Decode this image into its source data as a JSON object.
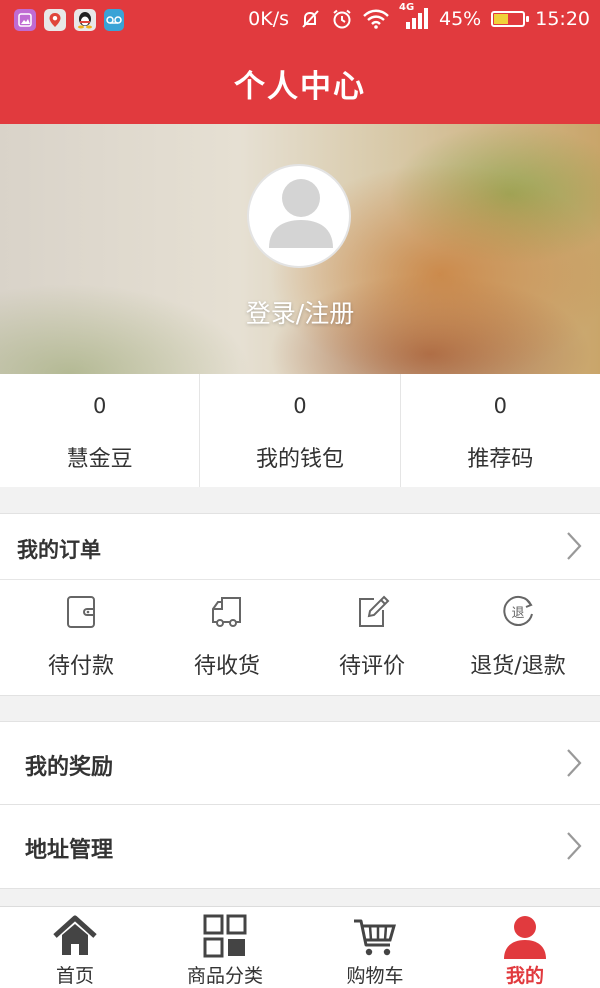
{
  "status_bar": {
    "apps": [
      {
        "icon": "image-app-icon",
        "color": "#c06bd3"
      },
      {
        "icon": "map-pin-app-icon",
        "color": "#e8e8e8"
      },
      {
        "icon": "qq-penguin-app-icon",
        "color": "#e8e8e8"
      },
      {
        "icon": "voicemail-app-icon",
        "color": "#3aa3d6"
      }
    ],
    "network_speed": "0K/s",
    "network_type": "4G",
    "battery_percent_text": "45%",
    "battery_level": 0.45,
    "time": "15:20"
  },
  "header": {
    "title": "个人中心"
  },
  "profile": {
    "login_label": "登录/注册"
  },
  "stats": [
    {
      "value": "0",
      "label": "慧金豆"
    },
    {
      "value": "0",
      "label": "我的钱包"
    },
    {
      "value": "0",
      "label": "推荐码"
    }
  ],
  "orders": {
    "title": "我的订单",
    "items": [
      {
        "label": "待付款",
        "icon": "wallet-icon"
      },
      {
        "label": "待收货",
        "icon": "delivery-truck-icon"
      },
      {
        "label": "待评价",
        "icon": "edit-review-icon"
      },
      {
        "label": "退货/退款",
        "icon": "return-refund-icon",
        "icon_text": "退"
      }
    ]
  },
  "menu": [
    {
      "label": "我的奖励"
    },
    {
      "label": "地址管理"
    }
  ],
  "tabbar": {
    "items": [
      {
        "label": "首页",
        "icon": "home-icon"
      },
      {
        "label": "商品分类",
        "icon": "category-grid-icon"
      },
      {
        "label": "购物车",
        "icon": "shopping-cart-icon"
      },
      {
        "label": "我的",
        "icon": "user-profile-icon",
        "active": true
      }
    ]
  },
  "colors": {
    "accent": "#e13a3e",
    "text": "#333333",
    "icon_gray": "#666666",
    "tab_icon": "#444444"
  }
}
